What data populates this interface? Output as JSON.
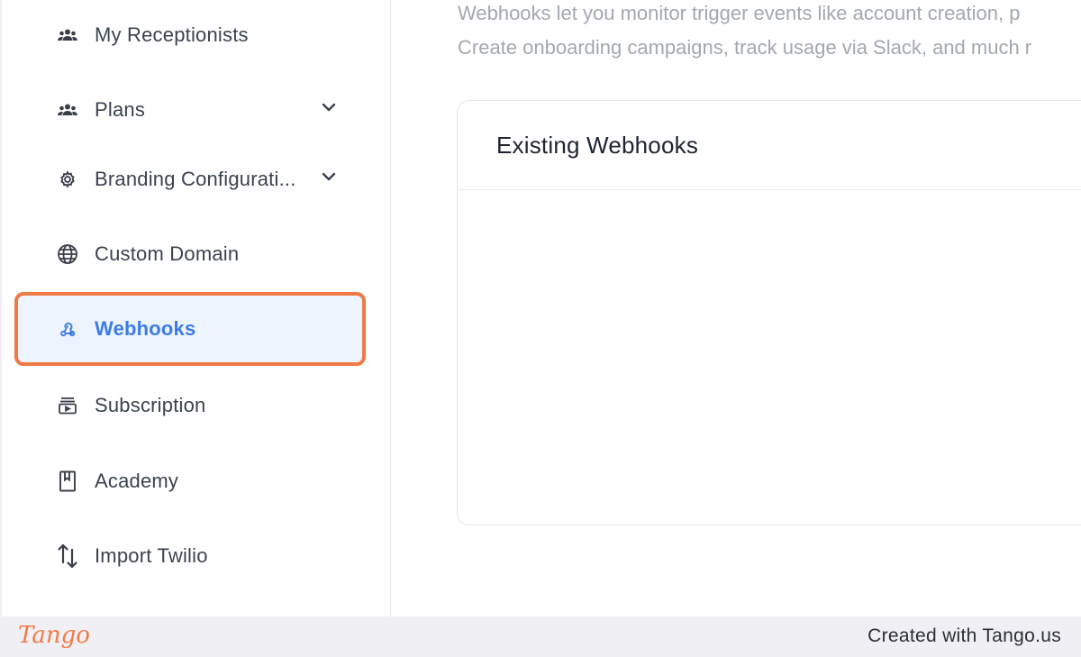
{
  "sidebar": {
    "items": [
      {
        "label": "My Receptionists",
        "icon": "people-icon"
      },
      {
        "label": "Plans",
        "icon": "people-icon",
        "has_chevron": true
      },
      {
        "label": "Branding Configurati...",
        "icon": "gear-icon",
        "has_chevron": true
      },
      {
        "label": "Custom Domain",
        "icon": "globe-icon"
      },
      {
        "label": "Webhooks",
        "icon": "webhook-icon",
        "active": true
      },
      {
        "label": "Subscription",
        "icon": "subscription-icon"
      },
      {
        "label": "Academy",
        "icon": "book-icon"
      },
      {
        "label": "Import Twilio",
        "icon": "arrows-up-down-icon"
      }
    ]
  },
  "main": {
    "description_line1": "Webhooks let you monitor trigger events like account creation, p",
    "description_line2": "Create onboarding campaigns, track usage via Slack, and much r",
    "card_title": "Existing Webhooks"
  },
  "footer": {
    "logo": "Tango",
    "credit": "Created with Tango.us"
  },
  "colors": {
    "accent": "#3d7be6",
    "highlight_border": "#f07a45",
    "active_bg": "#edf4fd"
  }
}
